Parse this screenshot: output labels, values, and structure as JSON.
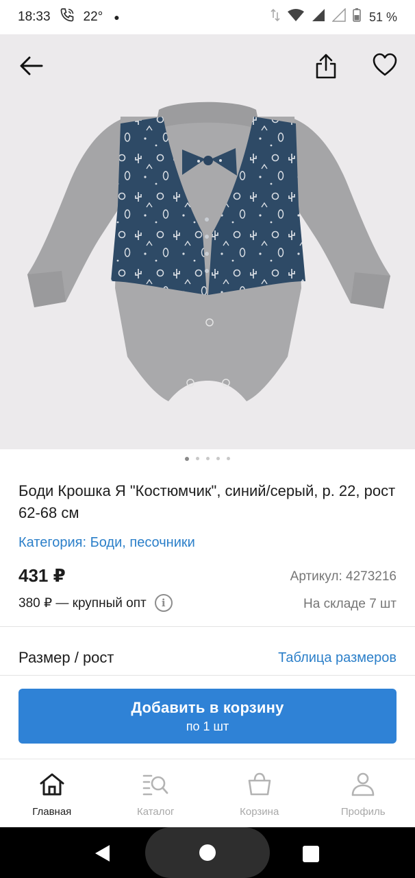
{
  "status_bar": {
    "time": "18:33",
    "temperature": "22°",
    "battery": "51 %",
    "icons": [
      "phone-call-icon",
      "wifi-icon",
      "signal-icon",
      "battery-icon"
    ]
  },
  "product": {
    "title": "Боди Крошка Я \"Костюмчик\", синий/серый, р. 22, рост 62-68 см",
    "category": "Категория: Боди, песочники",
    "price": "431 ₽",
    "article": "Артикул: 4273216",
    "wholesale": "380 ₽ — крупный опт",
    "stock": "На складе 7 шт",
    "image_count": 5,
    "active_image_index": 0
  },
  "size": {
    "label": "Размер / рост",
    "table_link": "Таблица размеров"
  },
  "cart_button": {
    "label": "Добавить в корзину",
    "sub": "по 1 шт"
  },
  "nav": {
    "items": [
      {
        "label": "Главная",
        "icon": "home-icon",
        "active": true
      },
      {
        "label": "Каталог",
        "icon": "catalog-search-icon",
        "active": false
      },
      {
        "label": "Корзина",
        "icon": "basket-icon",
        "active": false
      },
      {
        "label": "Профиль",
        "icon": "profile-icon",
        "active": false
      }
    ]
  },
  "colors": {
    "accent": "#2f82d6",
    "link": "#2b7fc9",
    "vest": "#2e4a66",
    "body_grey": "#a7a7a9"
  }
}
